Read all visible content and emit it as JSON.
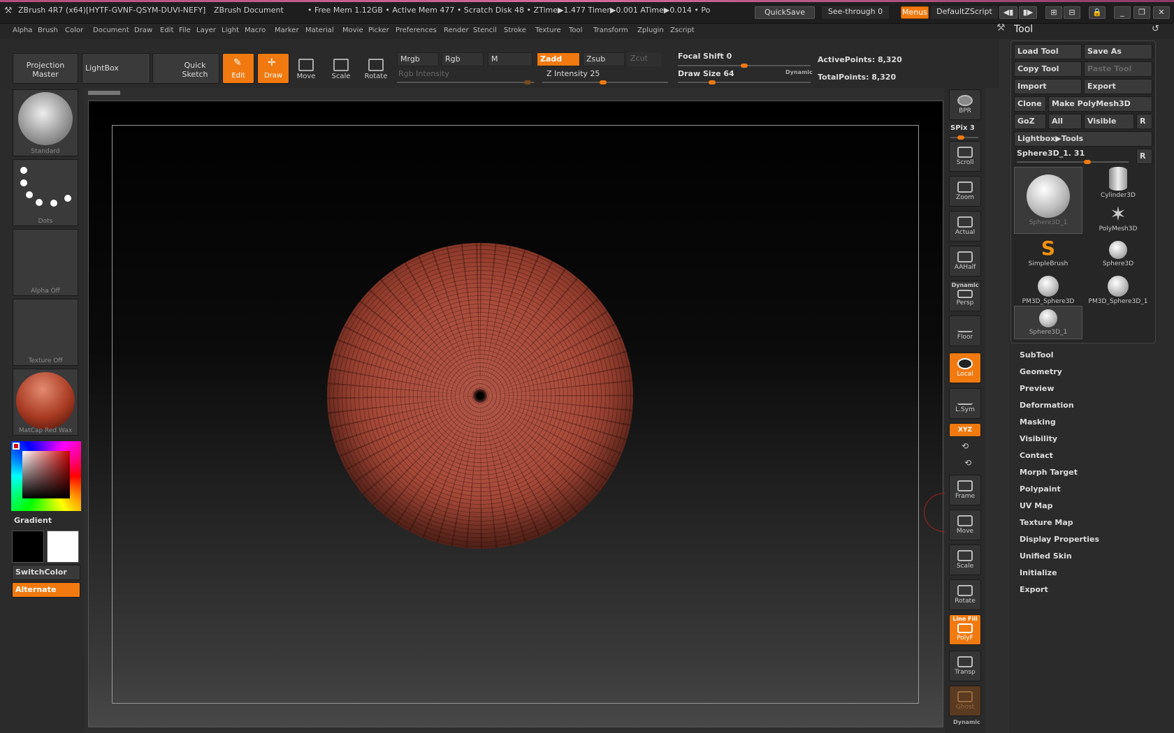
{
  "titlebar": {
    "app_title": "ZBrush 4R7 (x64)[HYTF-GVNF-QSYM-DUVI-NEFY]",
    "doc_title": "ZBrush Document",
    "stats": "• Free Mem 1.12GB • Active Mem 477 • Scratch Disk 48 • ZTime▶1.477 Timer▶0.001 ATime▶0.014 • Po",
    "quicksave": "QuickSave",
    "seethrough": "See-through 0",
    "menus": "Menus",
    "zscript": "DefaultZScript"
  },
  "menubar": [
    "Alpha",
    "Brush",
    "Color",
    "Document",
    "Draw",
    "Edit",
    "File",
    "Layer",
    "Light",
    "Macro",
    "Marker",
    "Material",
    "Movie",
    "Picker",
    "Preferences",
    "Render",
    "Stencil",
    "Stroke",
    "Texture",
    "Tool",
    "Transform",
    "Zplugin",
    "Zscript"
  ],
  "shelf": {
    "projection_master": "Projection Master",
    "lightbox": "LightBox",
    "quick_sketch": "Quick Sketch",
    "edit": "Edit",
    "draw": "Draw",
    "move": "Move",
    "scale": "Scale",
    "rotate": "Rotate",
    "mrgb": "Mrgb",
    "rgb": "Rgb",
    "m": "M",
    "zadd": "Zadd",
    "zsub": "Zsub",
    "zcut": "Zcut",
    "rgb_intensity": "Rgb Intensity",
    "z_intensity": "Z Intensity 25",
    "focal_shift": "Focal Shift 0",
    "draw_size": "Draw Size 64",
    "dynamic": "Dynamic",
    "active_points": "ActivePoints: 8,320",
    "total_points": "TotalPoints: 8,320"
  },
  "lefttray": {
    "brush": "Standard",
    "stroke": "Dots",
    "alpha": "Alpha Off",
    "texture": "Texture Off",
    "material": "MatCap Red Wax",
    "gradient": "Gradient",
    "switchcolor": "SwitchColor",
    "alternate": "Alternate"
  },
  "rightshelf": {
    "bpr": "BPR",
    "spix": "SPix 3",
    "scroll": "Scroll",
    "zoom": "Zoom",
    "actual": "Actual",
    "aahalf": "AAHalf",
    "dynamic": "Dynamic",
    "persp": "Persp",
    "floor": "Floor",
    "local": "Local",
    "lsym": "L.Sym",
    "xyz": "XYZ",
    "frame": "Frame",
    "move": "Move",
    "scale": "Scale",
    "rotate": "Rotate",
    "linefill": "Line Fill",
    "polyf": "PolyF",
    "transp": "Transp",
    "ghost": "Ghost",
    "dynamic2": "Dynamic"
  },
  "toolpalette": {
    "title": "Tool",
    "load_tool": "Load Tool",
    "save_as": "Save As",
    "copy_tool": "Copy Tool",
    "paste_tool": "Paste Tool",
    "import": "Import",
    "export": "Export",
    "clone": "Clone",
    "make_polymesh": "Make PolyMesh3D",
    "goz": "GoZ",
    "all": "All",
    "visible": "Visible",
    "r": "R",
    "lightbox_tools": "Lightbox▶Tools",
    "current_tool": "Sphere3D_1. 31",
    "thumbs": [
      "Sphere3D_1",
      "Cylinder3D",
      "PolyMesh3D",
      "SimpleBrush",
      "Sphere3D",
      "PM3D_Sphere3D",
      "PM3D_Sphere3D_1",
      "Sphere3D_1"
    ],
    "sections": [
      "SubTool",
      "Geometry",
      "Preview",
      "Deformation",
      "Masking",
      "Visibility",
      "Contact",
      "Morph Target",
      "Polypaint",
      "UV Map",
      "Texture Map",
      "Display Properties",
      "Unified Skin",
      "Initialize",
      "Export"
    ]
  }
}
